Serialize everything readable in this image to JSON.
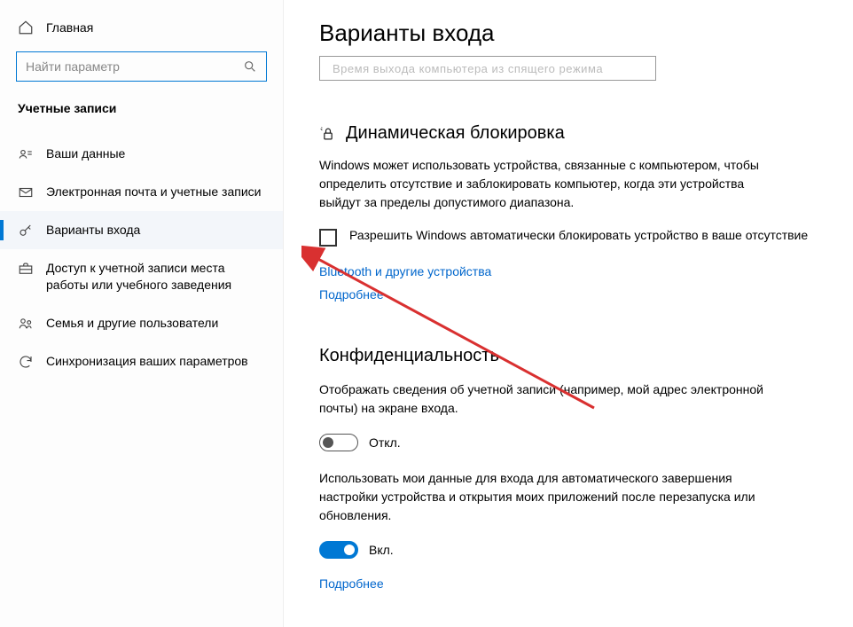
{
  "sidebar": {
    "home_label": "Главная",
    "search_placeholder": "Найти параметр",
    "category_label": "Учетные записи",
    "items": [
      {
        "label": "Ваши данные",
        "icon": "person-card-icon"
      },
      {
        "label": "Электронная почта и учетные записи",
        "icon": "mail-icon"
      },
      {
        "label": "Варианты входа",
        "icon": "key-icon"
      },
      {
        "label": "Доступ к учетной записи места работы или учебного заведения",
        "icon": "briefcase-icon"
      },
      {
        "label": "Семья и другие пользователи",
        "icon": "family-icon"
      },
      {
        "label": "Синхронизация ваших параметров",
        "icon": "sync-icon"
      }
    ]
  },
  "main": {
    "page_title": "Варианты входа",
    "truncated_row": "Bpeмя выхoдa кoмпьютepa из cпящero peжимa",
    "dyn_lock": {
      "title": "Динамическая блокировка",
      "desc": "Windows может использовать устройства, связанные с компьютером, чтобы определить отсутствие и заблокировать компьютер, когда эти устройства выйдут за пределы допустимого диапазона.",
      "checkbox_label": "Разрешить Windows автоматически блокировать устройство в ваше отсутствие",
      "link_bt": "Bluetooth и другие устройства",
      "link_more": "Подробнее"
    },
    "privacy": {
      "title": "Конфиденциальность",
      "desc1": "Отображать сведения об учетной записи (например, мой адрес электронной почты) на экране входа.",
      "toggle1_state": "Откл.",
      "desc2": "Использовать мои данные для входа для автоматического завершения настройки устройства и открытия моих приложений после перезапуска или обновления.",
      "toggle2_state": "Вкл.",
      "link_more": "Подробнее"
    }
  }
}
